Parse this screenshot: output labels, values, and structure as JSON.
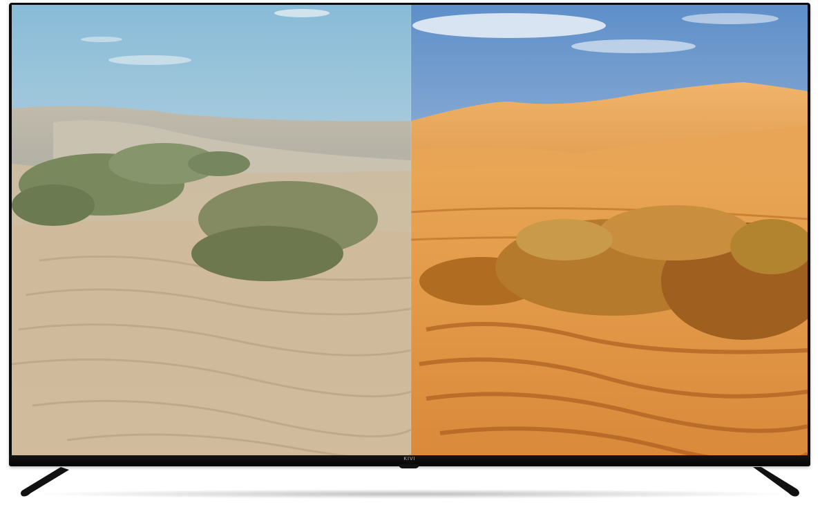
{
  "tv": {
    "brand_label": "KIVI"
  },
  "screen_image": {
    "left_half": "natural-color-desert",
    "right_half": "enhanced-color-desert"
  }
}
